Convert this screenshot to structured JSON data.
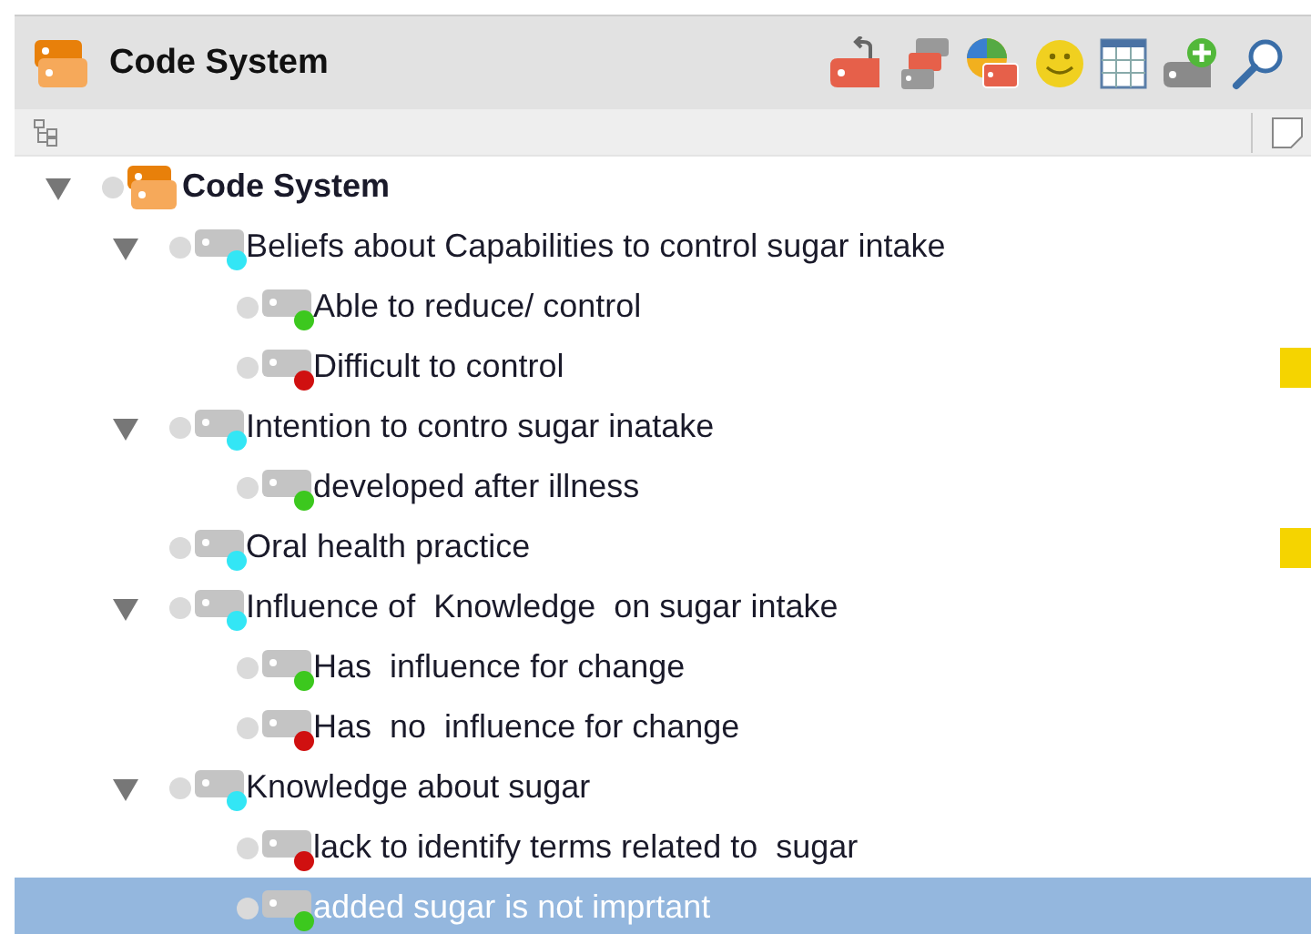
{
  "header": {
    "title": "Code System"
  },
  "tree": [
    {
      "label": "Code System",
      "kind": "system",
      "expanded": true,
      "selected": false,
      "children": [
        {
          "label": "Beliefs about Capabilities to control sugar intake",
          "kind": "code",
          "color": "#33e6f5",
          "expanded": true,
          "selected": false,
          "children": [
            {
              "label": "Able to reduce/ control",
              "kind": "code",
              "color": "#3cc81e",
              "selected": false,
              "flag": false
            },
            {
              "label": "Difficult to control",
              "kind": "code",
              "color": "#d01010",
              "selected": false,
              "flag": true
            }
          ]
        },
        {
          "label": "Intention to contro sugar inatake",
          "kind": "code",
          "color": "#33e6f5",
          "expanded": true,
          "selected": false,
          "children": [
            {
              "label": "developed after illness",
              "kind": "code",
              "color": "#3cc81e",
              "selected": false,
              "flag": false
            }
          ]
        },
        {
          "label": "Oral health practice",
          "kind": "code",
          "color": "#33e6f5",
          "selected": false,
          "flag": true
        },
        {
          "label": "Influence of  Knowledge  on sugar intake",
          "kind": "code",
          "color": "#33e6f5",
          "expanded": true,
          "selected": false,
          "children": [
            {
              "label": "Has  influence for change",
              "kind": "code",
              "color": "#3cc81e",
              "selected": false,
              "flag": false
            },
            {
              "label": "Has  no  influence for change",
              "kind": "code",
              "color": "#d01010",
              "selected": false,
              "flag": false
            }
          ]
        },
        {
          "label": "Knowledge about sugar",
          "kind": "code",
          "color": "#33e6f5",
          "expanded": true,
          "selected": false,
          "children": [
            {
              "label": "lack to identify terms related to  sugar",
              "kind": "code",
              "color": "#d01010",
              "selected": false,
              "flag": false
            },
            {
              "label": "added sugar is not imprtant",
              "kind": "code",
              "color": "#3cc81e",
              "selected": true,
              "flag": false
            }
          ]
        }
      ]
    }
  ]
}
